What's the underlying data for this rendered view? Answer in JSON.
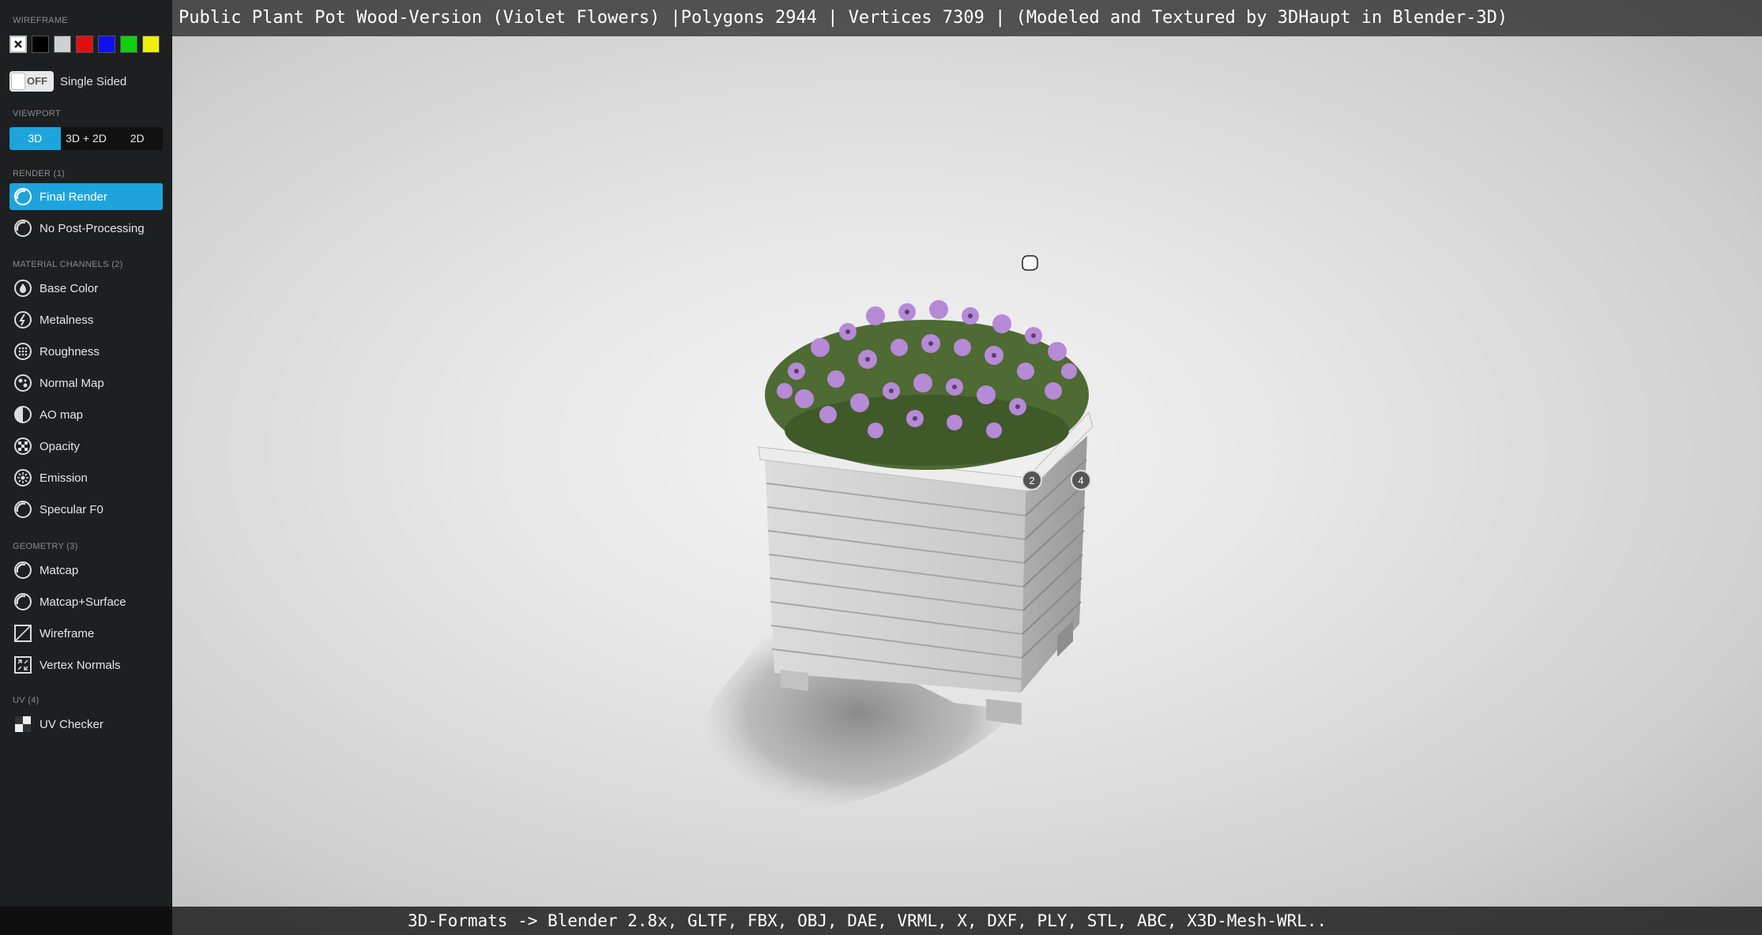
{
  "sidebar": {
    "wireframe_label": "WIREFRAME",
    "wireframe_swatches": [
      {
        "color": "#ffffff",
        "name": "wireframe-off-swatch",
        "glyph": "✖"
      },
      {
        "color": "#000000",
        "name": "black-swatch"
      },
      {
        "color": "#d0d0d0",
        "name": "white-swatch"
      },
      {
        "color": "#e01010",
        "name": "red-swatch"
      },
      {
        "color": "#1010ee",
        "name": "blue-swatch"
      },
      {
        "color": "#10d010",
        "name": "green-swatch"
      },
      {
        "color": "#eeee10",
        "name": "yellow-swatch"
      }
    ],
    "single_sided_toggle": "OFF",
    "single_sided_label": "Single Sided",
    "viewport_label": "VIEWPORT",
    "viewport_options": [
      "3D",
      "3D + 2D",
      "2D"
    ],
    "viewport_selected": "3D",
    "render_label": "RENDER (1)",
    "render_items": [
      "Final Render",
      "No Post-Processing"
    ],
    "material_label": "MATERIAL CHANNELS (2)",
    "material_items": [
      "Base Color",
      "Metalness",
      "Roughness",
      "Normal Map",
      "AO map",
      "Opacity",
      "Emission",
      "Specular F0"
    ],
    "geometry_label": "GEOMETRY (3)",
    "geometry_items": [
      "Matcap",
      "Matcap+Surface",
      "Wireframe",
      "Vertex Normals"
    ],
    "uv_label": "UV (4)",
    "uv_items": [
      "UV Checker"
    ],
    "accent_color": "#1ea4dc"
  },
  "viewport": {
    "title": "Public Plant Pot Wood-Version (Violet Flowers) |Polygons 2944 | Vertices 7309 | (Modeled and Textured by 3DHaupt in Blender-3D)",
    "formats": "3D-Formats -> Blender 2.8x, GLTF, FBX, OBJ, DAE, VRML, X, DXF, PLY, STL, ABC, X3D-Mesh-WRL..",
    "annotations": [
      "2",
      "4"
    ]
  }
}
